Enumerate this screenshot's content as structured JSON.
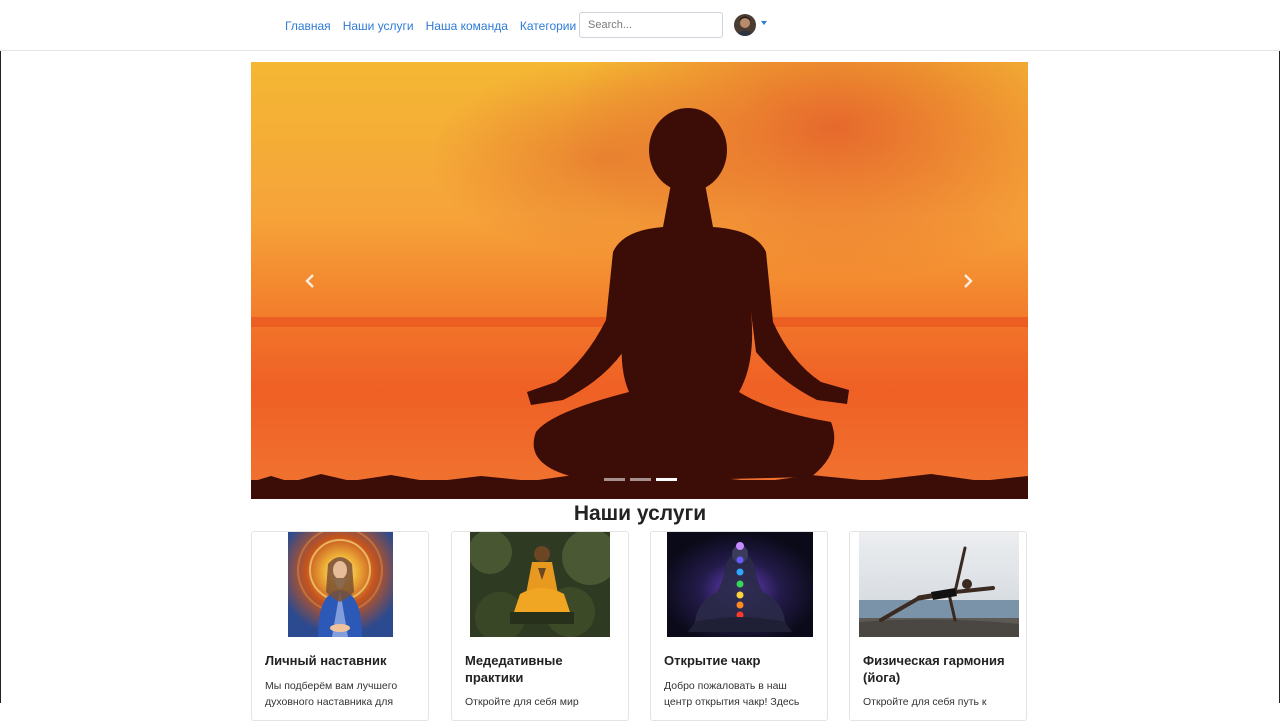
{
  "nav": {
    "links": [
      "Главная",
      "Наши услуги",
      "Наша команда",
      "Категории"
    ],
    "search_placeholder": "Search..."
  },
  "carousel": {
    "slide_count": 3,
    "active_index": 2
  },
  "services": {
    "title": "Наши услуги",
    "cards": [
      {
        "title": "Личный наставник",
        "text": "Мы подберём вам лучшего духовного наставника для"
      },
      {
        "title": "Медедативные практики",
        "text": "Откройте для себя мир"
      },
      {
        "title": "Открытие чакр",
        "text": "Добро пожаловать в наш центр открытия чакр! Здесь"
      },
      {
        "title": "Физическая гармония (йога)",
        "text": "Откройте для себя путь к"
      }
    ]
  },
  "colors": {
    "link": "#2f7bd6",
    "sky_top": "#f3b830",
    "sky_bottom": "#ef5a1e",
    "silhouette": "#3b0d06"
  }
}
